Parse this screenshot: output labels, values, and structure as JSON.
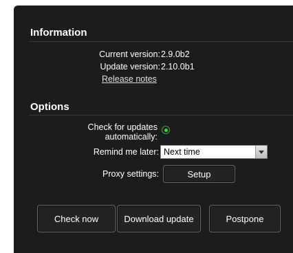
{
  "information": {
    "title": "Information",
    "current_version_label": "Current version:",
    "current_version_value": "2.9.0b2",
    "update_version_label": "Update version:",
    "update_version_value": "2.10.0b1",
    "release_notes_link": "Release notes"
  },
  "options": {
    "title": "Options",
    "check_updates_label_line1": "Check for updates",
    "check_updates_label_line2": "automatically:",
    "check_updates_checked": true,
    "remind_label": "Remind me later:",
    "remind_value": "Next time",
    "proxy_label": "Proxy settings:",
    "setup_button": "Setup"
  },
  "actions": {
    "check_now": "Check now",
    "download_update": "Download update",
    "postpone": "Postpone"
  },
  "colors": {
    "panel_bg": "#1c1c1c",
    "radio_accent": "#3ed14a"
  }
}
